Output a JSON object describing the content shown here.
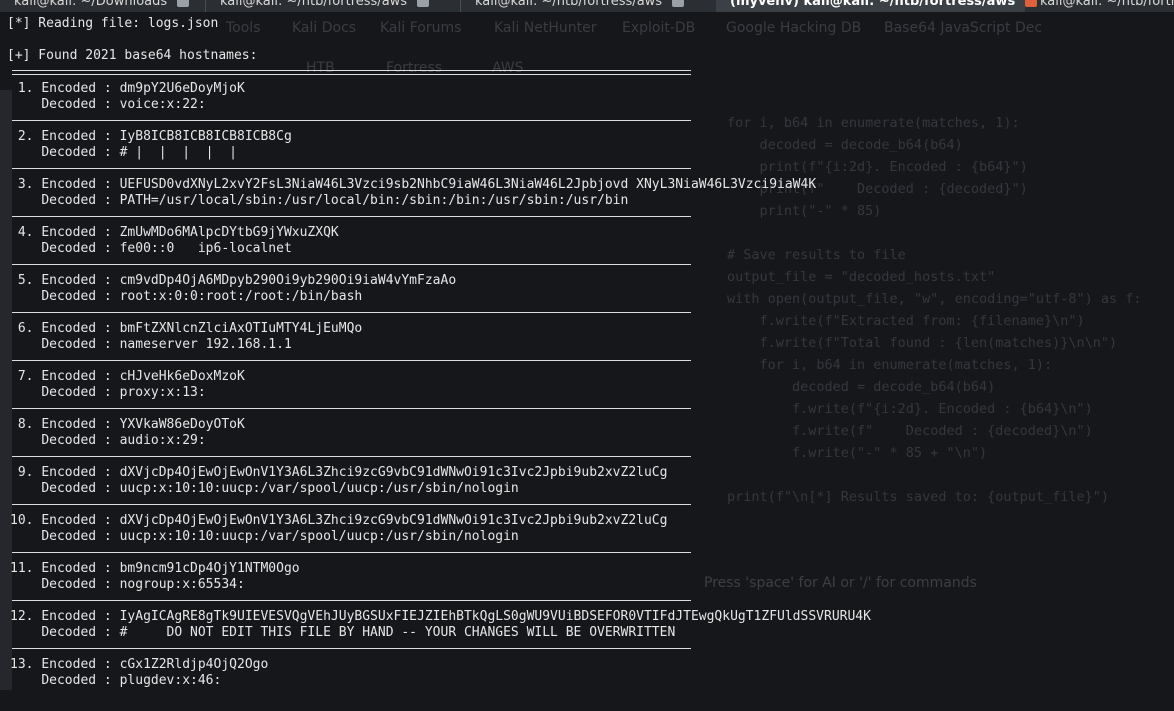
{
  "tabs": [
    {
      "title": "kali@kali: ~/Downloads",
      "active": false
    },
    {
      "title": "kali@kali: ~/htb/fortress/aws",
      "active": false
    },
    {
      "title": "kali@kali: ~/htb/fortress/aws",
      "active": false
    },
    {
      "title": "(myvenv) kali@kali: ~/htb/fortress/aws",
      "active": true
    },
    {
      "title": "kali@kali: ~/htb/fortress/aws",
      "active": false
    }
  ],
  "background_window": {
    "bookmarks": [
      "Tools",
      "Kali Docs",
      "Kali Forums",
      "Kali NetHunter",
      "Exploit-DB",
      "Google Hacking DB",
      "Base64 JavaScript Dec"
    ],
    "nav_tabs": [
      "HTB",
      "Fortress",
      "AWS"
    ],
    "code_lines": [
      "for i, b64 in enumerate(matches, 1):",
      "    decoded = decode_b64(b64)",
      "    print(f\"{i:2d}. Encoded : {b64}\")",
      "    print(f\"    Decoded : {decoded}\")",
      "    print(\"-\" * 85)",
      "",
      "# Save results to file",
      "output_file = \"decoded_hosts.txt\"",
      "with open(output_file, \"w\", encoding=\"utf-8\") as f:",
      "    f.write(f\"Extracted from: {filename}\\n\")",
      "    f.write(f\"Total found : {len(matches)}\\n\\n\")",
      "    for i, b64 in enumerate(matches, 1):",
      "        decoded = decode_b64(b64)",
      "        f.write(f\"{i:2d}. Encoded : {b64}\\n\")",
      "        f.write(f\"    Decoded : {decoded}\\n\")",
      "        f.write(\"-\" * 85 + \"\\n\")",
      "",
      "print(f\"\\n[*] Results saved to: {output_file}\")"
    ],
    "prompt_hint": "Press 'space' for AI or '/' for commands"
  },
  "terminal": {
    "reading_line": "[*] Reading file: logs.json",
    "found_line": "[+] Found 2021 base64 hostnames:",
    "encoded_label": "Encoded : ",
    "decoded_label": "Decoded : ",
    "entries": [
      {
        "num": " 1.",
        "encoded": "dm9pY2U6eDoyMjoK",
        "decoded": "voice:x:22:"
      },
      {
        "num": " 2.",
        "encoded": "IyB8ICB8ICB8ICB8ICB8Cg",
        "decoded": "# |  |  |  |  |"
      },
      {
        "num": " 3.",
        "encoded": "UEFUSD0vdXNyL2xvY2FsL3NiaW46L3Vzci9sb2NhbC9iaW46L3NiaW46L2Jpbjovd XNyL3NiaW46L3Vzci9iaW4K",
        "decoded": "PATH=/usr/local/sbin:/usr/local/bin:/sbin:/bin:/usr/sbin:/usr/bin"
      },
      {
        "num": " 4.",
        "encoded": "ZmUwMDo6MAlpcDYtbG9jYWxuZXQK",
        "decoded": "fe00::0   ip6-localnet"
      },
      {
        "num": " 5.",
        "encoded": "cm9vdDp4OjA6MDpyb290Oi9yb290Oi9iaW4vYmFzaAo",
        "decoded": "root:x:0:0:root:/root:/bin/bash"
      },
      {
        "num": " 6.",
        "encoded": "bmFtZXNlcnZlciAxOTIuMTY4LjEuMQo",
        "decoded": "nameserver 192.168.1.1"
      },
      {
        "num": " 7.",
        "encoded": "cHJveHk6eDoxMzoK",
        "decoded": "proxy:x:13:"
      },
      {
        "num": " 8.",
        "encoded": "YXVkaW86eDoyOToK",
        "decoded": "audio:x:29:"
      },
      {
        "num": " 9.",
        "encoded": "dXVjcDp4OjEwOjEwOnV1Y3A6L3Zhci9zcG9vbC91dWNwOi91c3Ivc2Jpbi9ub2xvZ2luCg",
        "decoded": "uucp:x:10:10:uucp:/var/spool/uucp:/usr/sbin/nologin"
      },
      {
        "num": "10.",
        "encoded": "dXVjcDp4OjEwOjEwOnV1Y3A6L3Zhci9zcG9vbC91dWNwOi91c3Ivc2Jpbi9ub2xvZ2luCg",
        "decoded": "uucp:x:10:10:uucp:/var/spool/uucp:/usr/sbin/nologin"
      },
      {
        "num": "11.",
        "encoded": "bm9ncm91cDp4OjY1NTM0Ogo",
        "decoded": "nogroup:x:65534:"
      },
      {
        "num": "12.",
        "encoded": "IyAgICAgRE8gTk9UIEVESVQgVEhJUyBGSUxFIEJZIEhBTkQgLS0gWU9VUiBDSEFOR0VTIFdJTEwgQkUgT1ZFUldSSVRURU4K",
        "decoded": "#     DO NOT EDIT THIS FILE BY HAND -- YOUR CHANGES WILL BE OVERWRITTEN"
      },
      {
        "num": "13.",
        "encoded": "cGx1Z2Rldjp4OjQ2Ogo",
        "decoded": "plugdev:x:46:"
      }
    ]
  }
}
